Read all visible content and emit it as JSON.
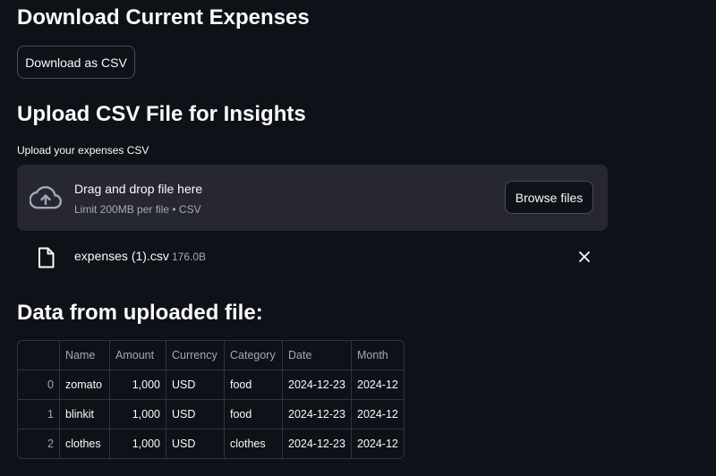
{
  "download_section": {
    "heading": "Download Current Expenses",
    "button_label": "Download as CSV"
  },
  "upload_section": {
    "heading": "Upload CSV File for Insights",
    "label": "Upload your expenses CSV",
    "dropzone": {
      "title": "Drag and drop file here",
      "limit": "Limit 200MB per file • CSV",
      "browse_label": "Browse files",
      "icon": "cloud-upload-icon"
    },
    "file": {
      "name": "expenses (1).csv",
      "size": "176.0B",
      "icon": "file-icon"
    }
  },
  "data_section": {
    "heading": "Data from uploaded file:",
    "table": {
      "columns": [
        "",
        "Name",
        "Amount",
        "Currency",
        "Category",
        "Date",
        "Month"
      ],
      "rows": [
        [
          "0",
          "zomato",
          "1,000",
          "USD",
          "food",
          "2024-12-23",
          "2024-12"
        ],
        [
          "1",
          "blinkit",
          "1,000",
          "USD",
          "food",
          "2024-12-23",
          "2024-12"
        ],
        [
          "2",
          "clothes",
          "1,000",
          "USD",
          "clothes",
          "2024-12-23",
          "2024-12"
        ]
      ]
    }
  },
  "colors": {
    "background": "#0e1117",
    "surface": "#262730",
    "border": "#31333f",
    "text": "#fafafa",
    "muted_text": "#a3a8b8"
  }
}
